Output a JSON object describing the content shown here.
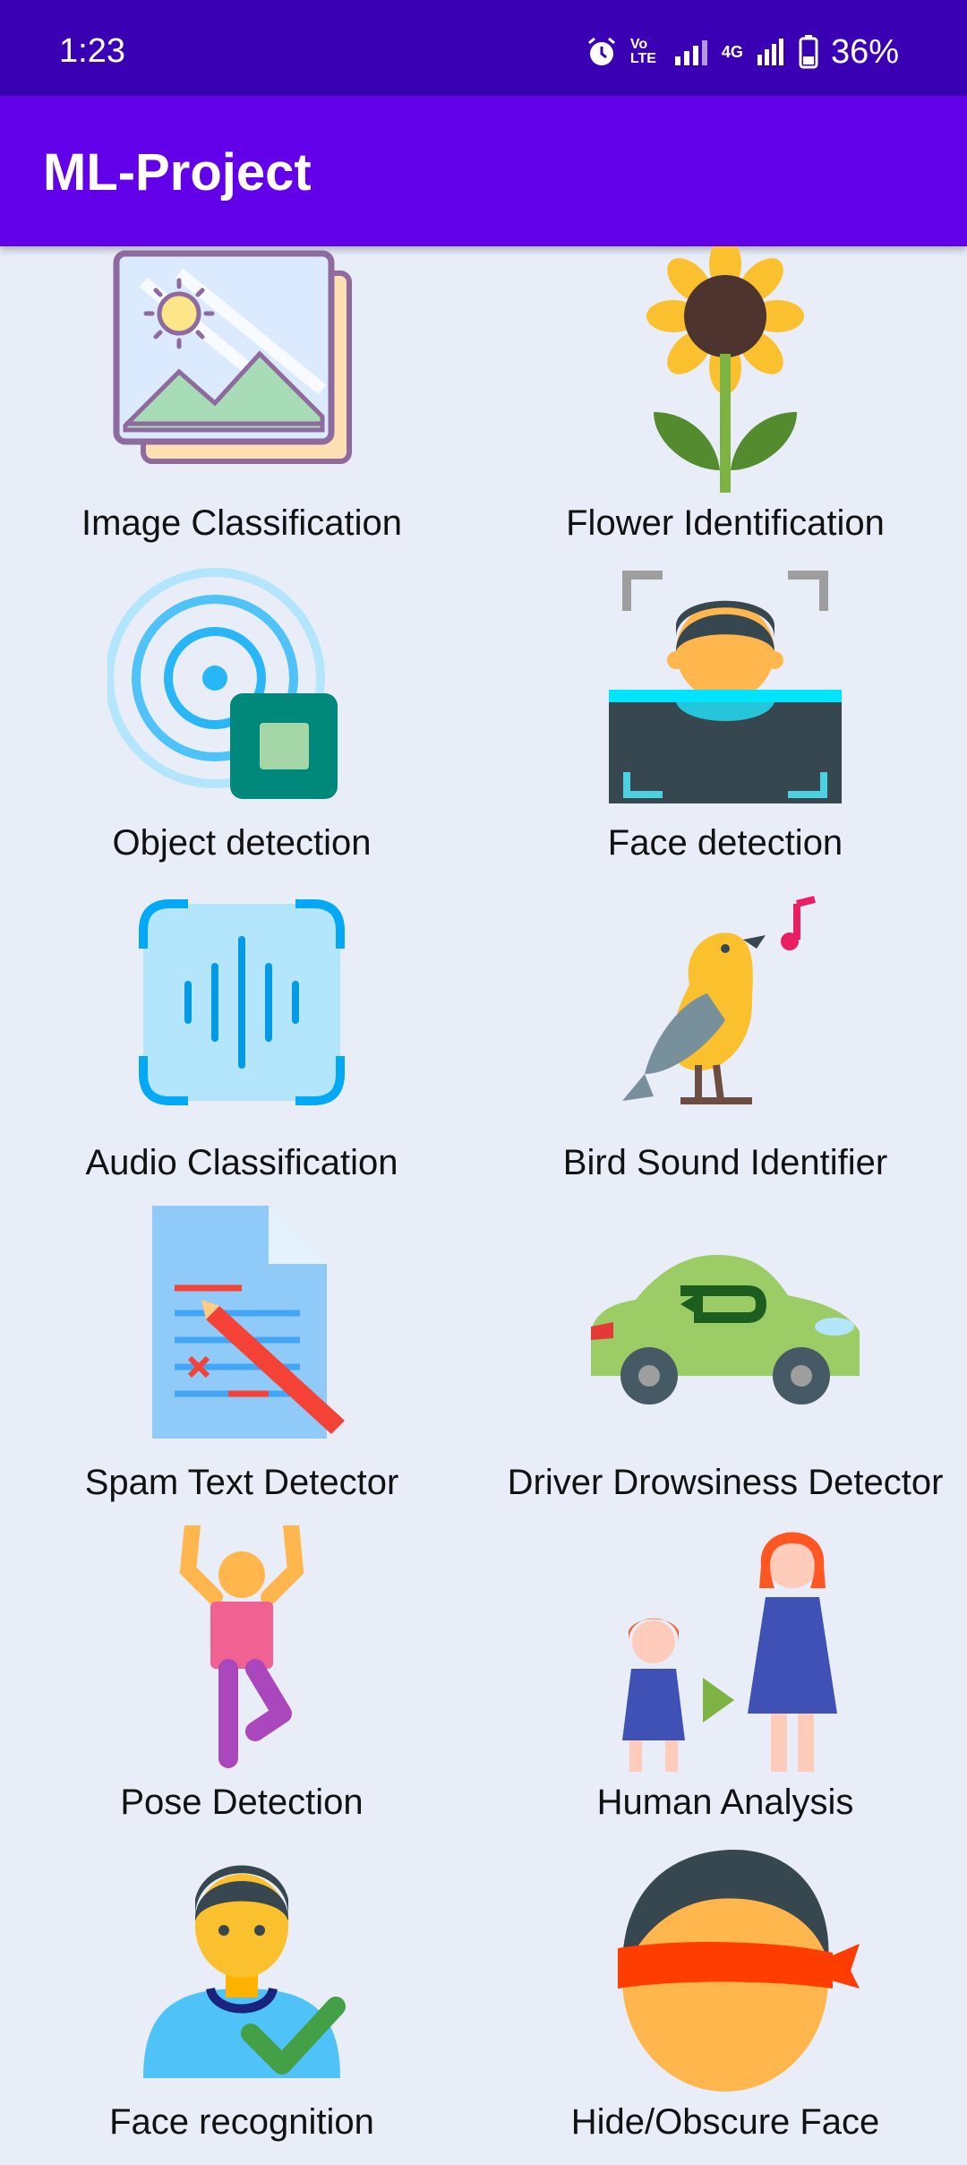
{
  "status_bar": {
    "time": "1:23",
    "network_4g": "4G",
    "volte": "Vo LTE",
    "battery": "36%"
  },
  "app_bar": {
    "title": "ML-Project"
  },
  "features": [
    {
      "label": "Image Classification",
      "icon": "image-gallery-icon"
    },
    {
      "label": "Flower Identification",
      "icon": "sunflower-icon"
    },
    {
      "label": "Object detection",
      "icon": "radar-target-icon"
    },
    {
      "label": "Face detection",
      "icon": "face-scan-icon"
    },
    {
      "label": "Audio Classification",
      "icon": "audio-wave-icon"
    },
    {
      "label": "Bird Sound Identifier",
      "icon": "singing-bird-icon"
    },
    {
      "label": "Spam Text Detector",
      "icon": "document-edit-icon"
    },
    {
      "label": "Driver Drowsiness Detector",
      "icon": "car-icon"
    },
    {
      "label": "Pose Detection",
      "icon": "yoga-pose-icon"
    },
    {
      "label": "Human Analysis",
      "icon": "child-to-adult-icon"
    },
    {
      "label": "Face recognition",
      "icon": "person-check-icon"
    },
    {
      "label": "Hide/Obscure Face",
      "icon": "blindfold-face-icon"
    }
  ],
  "colors": {
    "status_bar": "#3a00b3",
    "app_bar": "#6200ea",
    "background": "#e8edf8"
  }
}
